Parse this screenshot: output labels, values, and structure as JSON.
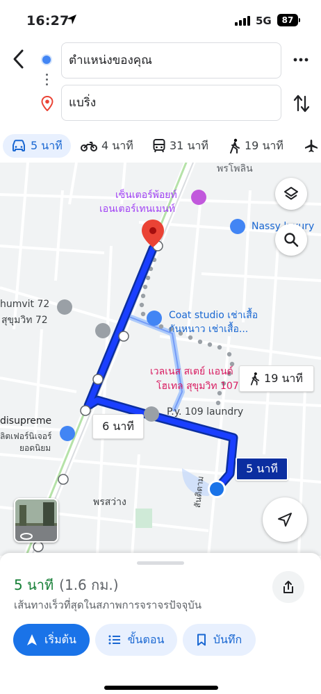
{
  "status_bar": {
    "time": "16:27",
    "network": "5G",
    "battery": "87"
  },
  "directions": {
    "origin": "ตำแหน่งของคุณ",
    "destination": "แบริ่ง"
  },
  "modes": [
    {
      "icon": "car-icon",
      "label": "5 นาที",
      "active": true
    },
    {
      "icon": "motorcycle-icon",
      "label": "4 นาที"
    },
    {
      "icon": "transit-icon",
      "label": "31 นาที"
    },
    {
      "icon": "walk-icon",
      "label": "19 นาที"
    },
    {
      "icon": "flight-icon",
      "label": ""
    }
  ],
  "map": {
    "labels": {
      "road_top": "พรโพลิน",
      "place_center_1": "เซ็นเตอร์พ้อยท์",
      "place_center_2": "เอนเตอร์เทนเมนท์",
      "place_nassy": "Nassy luxury",
      "place_sukhumvit_1": "humvit 72",
      "place_sukhumvit_2": "สุขุมวิท 72",
      "place_coat_1": "Coat studio เช่าเสื้อ",
      "place_coat_2": "กันหนาว เช่าเสื้อ...",
      "place_wellness_1": "เวลเนส สเตย์ แอนด์",
      "place_wellness_2": "โฮเทล สุขุมวิท 107",
      "place_laundry": "P.y. 109 laundry",
      "place_disu_1": "disupreme",
      "place_disu_2": "ลิตเฟอร์นิเจอร์",
      "place_disu_3": "ยอดนิยม",
      "area_south": "พรสว่าง",
      "road_side": "สันติตาม"
    },
    "route_tags": {
      "walk": "19 นาที",
      "alt_drive": "6 นาที",
      "main_drive": "5 นาที"
    }
  },
  "sheet": {
    "eta_time": "5 นาที",
    "eta_distance": "(1.6 กม.)",
    "subtitle": "เส้นทางเร็วที่สุดในสภาพการจราจรปัจจุบัน",
    "buttons": {
      "start": "เริ่มต้น",
      "steps": "ขั้นตอน",
      "save": "บันทึก"
    }
  },
  "colors": {
    "route": "#1a3fff",
    "accent": "#1a73e8",
    "eta_green": "#188038",
    "destination_pin": "#ea4335"
  }
}
